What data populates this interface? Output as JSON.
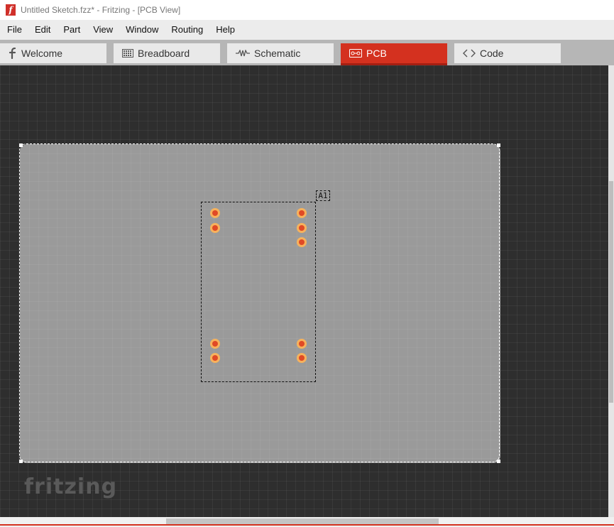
{
  "window": {
    "title": "Untitled Sketch.fzz* - Fritzing - [PCB View]",
    "app_icon_letter": "f"
  },
  "menu": {
    "items": [
      "File",
      "Edit",
      "Part",
      "View",
      "Window",
      "Routing",
      "Help"
    ]
  },
  "tabs": [
    {
      "label": "Welcome",
      "icon": "fritzing-f-icon",
      "active": false
    },
    {
      "label": "Breadboard",
      "icon": "breadboard-icon",
      "active": false
    },
    {
      "label": "Schematic",
      "icon": "resistor-icon",
      "active": false
    },
    {
      "label": "PCB",
      "icon": "pcb-icon",
      "active": true
    },
    {
      "label": "Code",
      "icon": "code-brackets-icon",
      "active": false
    }
  ],
  "canvas": {
    "part_label": "A1",
    "logo_text": "fritzing"
  },
  "colors": {
    "accent": "#d4311f",
    "canvas_bg": "#2e2e2e",
    "board": "#9a9a9a",
    "pad_ring": "#f7b25c",
    "pad_center": "#e04a26"
  }
}
